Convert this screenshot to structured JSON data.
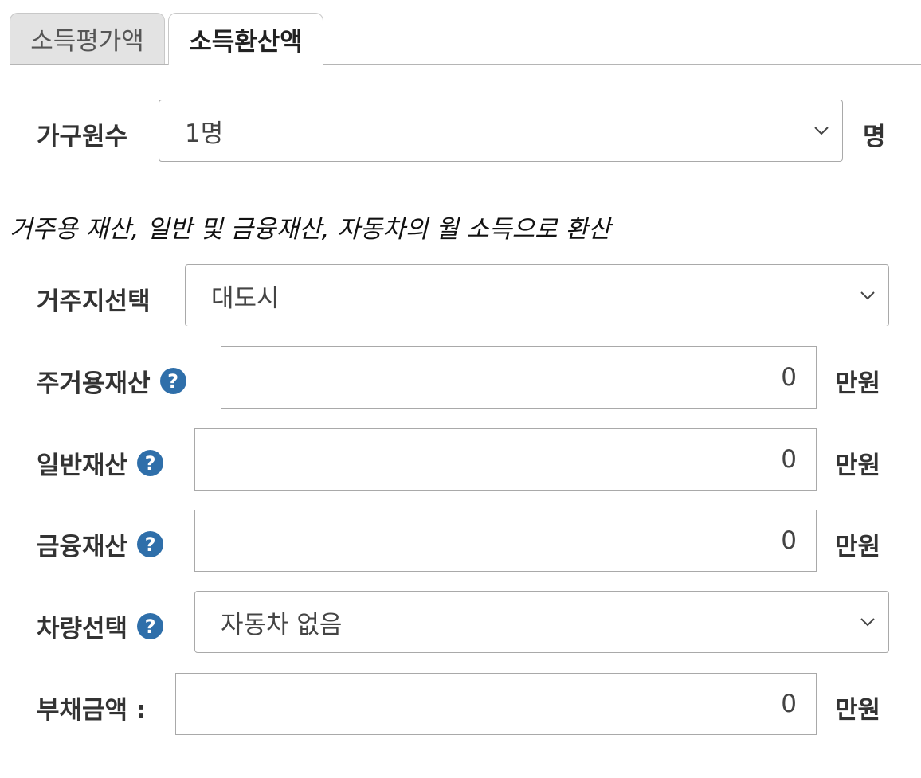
{
  "tabs": [
    {
      "label": "소득평가액",
      "active": false
    },
    {
      "label": "소득환산액",
      "active": true
    }
  ],
  "household": {
    "label": "가구원수",
    "value": "1명",
    "unit": "명"
  },
  "note": "거주용 재산, 일반 및 금융재산, 자동차의 월 소득으로 환산",
  "residence": {
    "label": "거주지선택",
    "value": "대도시"
  },
  "housing_asset": {
    "label": "주거용재산",
    "help": "?",
    "value": "0",
    "unit": "만원"
  },
  "general_asset": {
    "label": "일반재산",
    "help": "?",
    "value": "0",
    "unit": "만원"
  },
  "financial_asset": {
    "label": "금융재산",
    "help": "?",
    "value": "0",
    "unit": "만원"
  },
  "vehicle": {
    "label": "차량선택",
    "help": "?",
    "value": "자동차 없음"
  },
  "debt": {
    "label": "부채금액 :",
    "value": "0",
    "unit": "만원"
  },
  "colors": {
    "help_icon": "#2f6faa",
    "inactive_tab": "#e3e3e3",
    "border": "#a9a9a9"
  }
}
